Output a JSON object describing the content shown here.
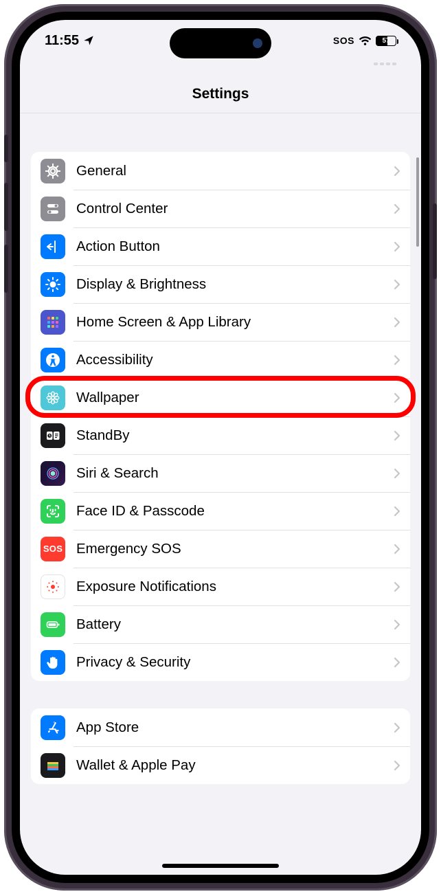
{
  "status": {
    "time": "11:55",
    "sos": "SOS",
    "battery_pct": "57",
    "battery_fill_pct": 57
  },
  "nav": {
    "title": "Settings"
  },
  "groups": [
    {
      "rows": [
        {
          "id": "general",
          "label": "General",
          "iconClass": "bg-grey",
          "iconName": "gear-icon"
        },
        {
          "id": "control-center",
          "label": "Control Center",
          "iconClass": "bg-grey",
          "iconName": "switches-icon"
        },
        {
          "id": "action-button",
          "label": "Action Button",
          "iconClass": "bg-blue",
          "iconName": "action-button-icon"
        },
        {
          "id": "display",
          "label": "Display & Brightness",
          "iconClass": "bg-blue",
          "iconName": "sun-icon"
        },
        {
          "id": "home-screen",
          "label": "Home Screen & App Library",
          "iconClass": "bg-darkblue",
          "iconName": "apps-grid-icon"
        },
        {
          "id": "accessibility",
          "label": "Accessibility",
          "iconClass": "bg-blue",
          "iconName": "accessibility-icon"
        },
        {
          "id": "wallpaper",
          "label": "Wallpaper",
          "iconClass": "bg-teal",
          "iconName": "flower-icon",
          "highlighted": true
        },
        {
          "id": "standby",
          "label": "StandBy",
          "iconClass": "bg-black",
          "iconName": "standby-icon"
        },
        {
          "id": "siri",
          "label": "Siri & Search",
          "iconClass": "bg-siri",
          "iconName": "siri-icon"
        },
        {
          "id": "face-id",
          "label": "Face ID & Passcode",
          "iconClass": "bg-green",
          "iconName": "face-id-icon"
        },
        {
          "id": "emergency-sos",
          "label": "Emergency SOS",
          "iconClass": "bg-red",
          "iconName": "sos-icon"
        },
        {
          "id": "exposure",
          "label": "Exposure Notifications",
          "iconClass": "bg-white",
          "iconName": "exposure-icon"
        },
        {
          "id": "battery",
          "label": "Battery",
          "iconClass": "bg-green",
          "iconName": "battery-icon"
        },
        {
          "id": "privacy",
          "label": "Privacy & Security",
          "iconClass": "bg-blue",
          "iconName": "hand-icon"
        }
      ]
    },
    {
      "rows": [
        {
          "id": "app-store",
          "label": "App Store",
          "iconClass": "bg-blue",
          "iconName": "app-store-icon"
        },
        {
          "id": "wallet",
          "label": "Wallet & Apple Pay",
          "iconClass": "bg-black",
          "iconName": "wallet-icon"
        }
      ]
    }
  ]
}
